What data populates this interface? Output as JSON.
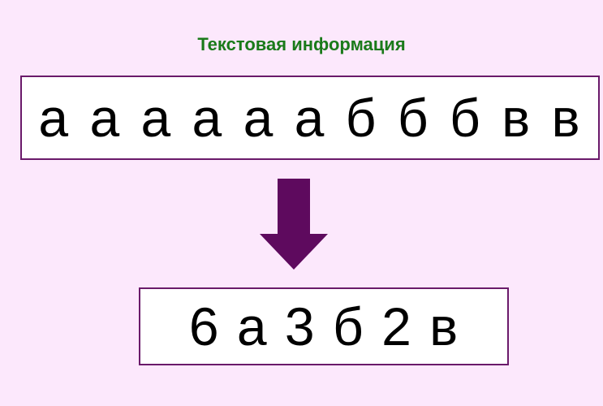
{
  "title": "Текстовая информация",
  "source": {
    "text": "а а а а а а б б б в в"
  },
  "result": {
    "text": "6 а 3 б 2 в"
  },
  "colors": {
    "background": "#fce8fc",
    "title": "#1a7a1a",
    "border": "#6a1a6a",
    "arrow": "#5e0a5e"
  },
  "icons": {
    "arrow": "arrow-down-icon"
  }
}
